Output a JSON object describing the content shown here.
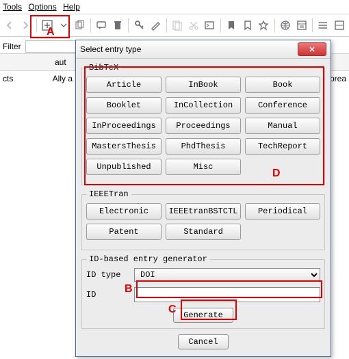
{
  "menubar": {
    "tools": "Tools",
    "options": "Options",
    "help": "Help"
  },
  "filter": {
    "label": "Filter"
  },
  "grid": {
    "header_author": "aut",
    "cell_left": "cts",
    "cell_author": "Ally a",
    "cell_right": "n sprea"
  },
  "dialog": {
    "title": "Select entry type",
    "groups": {
      "bibtex": "BibTeX",
      "ieee": "IEEETran",
      "idgen": "ID-based entry generator"
    },
    "bibtex": {
      "r1": [
        "Article",
        "InBook",
        "Book"
      ],
      "r2": [
        "Booklet",
        "InCollection",
        "Conference"
      ],
      "r3": [
        "InProceedings",
        "Proceedings",
        "Manual"
      ],
      "r4": [
        "MastersThesis",
        "PhdThesis",
        "TechReport"
      ],
      "r5": [
        "Unpublished",
        "Misc"
      ]
    },
    "ieee": {
      "r1": [
        "Electronic",
        "IEEEtranBSTCTL",
        "Periodical"
      ],
      "r2": [
        "Patent",
        "Standard"
      ]
    },
    "idgen": {
      "idtype_label": "ID type",
      "idtype_value": "DOI",
      "id_label": "ID",
      "id_value": ""
    },
    "generate": "Generate",
    "cancel": "Cancel"
  },
  "labels": {
    "A": "A",
    "B": "B",
    "C": "C",
    "D": "D"
  }
}
